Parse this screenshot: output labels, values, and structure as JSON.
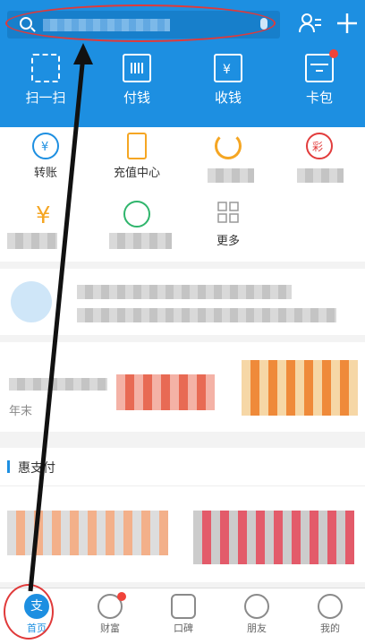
{
  "search": {
    "placeholder": ""
  },
  "quick_actions": [
    "扫一扫",
    "付钱",
    "收钱",
    "卡包"
  ],
  "grid_items": [
    {
      "label": "转账",
      "icon": "transfer-icon",
      "color": "#1d8fe1"
    },
    {
      "label": "充值中心",
      "icon": "phone-topup-icon",
      "color": "#f5a623"
    },
    {
      "label": "",
      "icon": "didi-icon",
      "color": "#f5a623"
    },
    {
      "label": "",
      "icon": "lottery-icon",
      "color": "#e23c3c"
    },
    {
      "label": "",
      "icon": "yuebao-icon",
      "color": "#f5a623"
    },
    {
      "label": "",
      "icon": "ant-forest-icon",
      "color": "#2fb56c"
    },
    {
      "label": "更多",
      "icon": "more-grid-icon",
      "color": "#888888"
    }
  ],
  "sections": {
    "discount_title": "惠支付",
    "banner_prefix": "年末"
  },
  "tabs": [
    {
      "label": "首页",
      "icon": "alipay-home-icon",
      "active": true
    },
    {
      "label": "财富",
      "icon": "wealth-icon",
      "active": false
    },
    {
      "label": "口碑",
      "icon": "koubei-icon",
      "active": false
    },
    {
      "label": "朋友",
      "icon": "friends-icon",
      "active": false
    },
    {
      "label": "我的",
      "icon": "profile-icon",
      "active": false
    }
  ],
  "colors": {
    "brand": "#1d8fe1",
    "annotation": "#e03a3a"
  }
}
